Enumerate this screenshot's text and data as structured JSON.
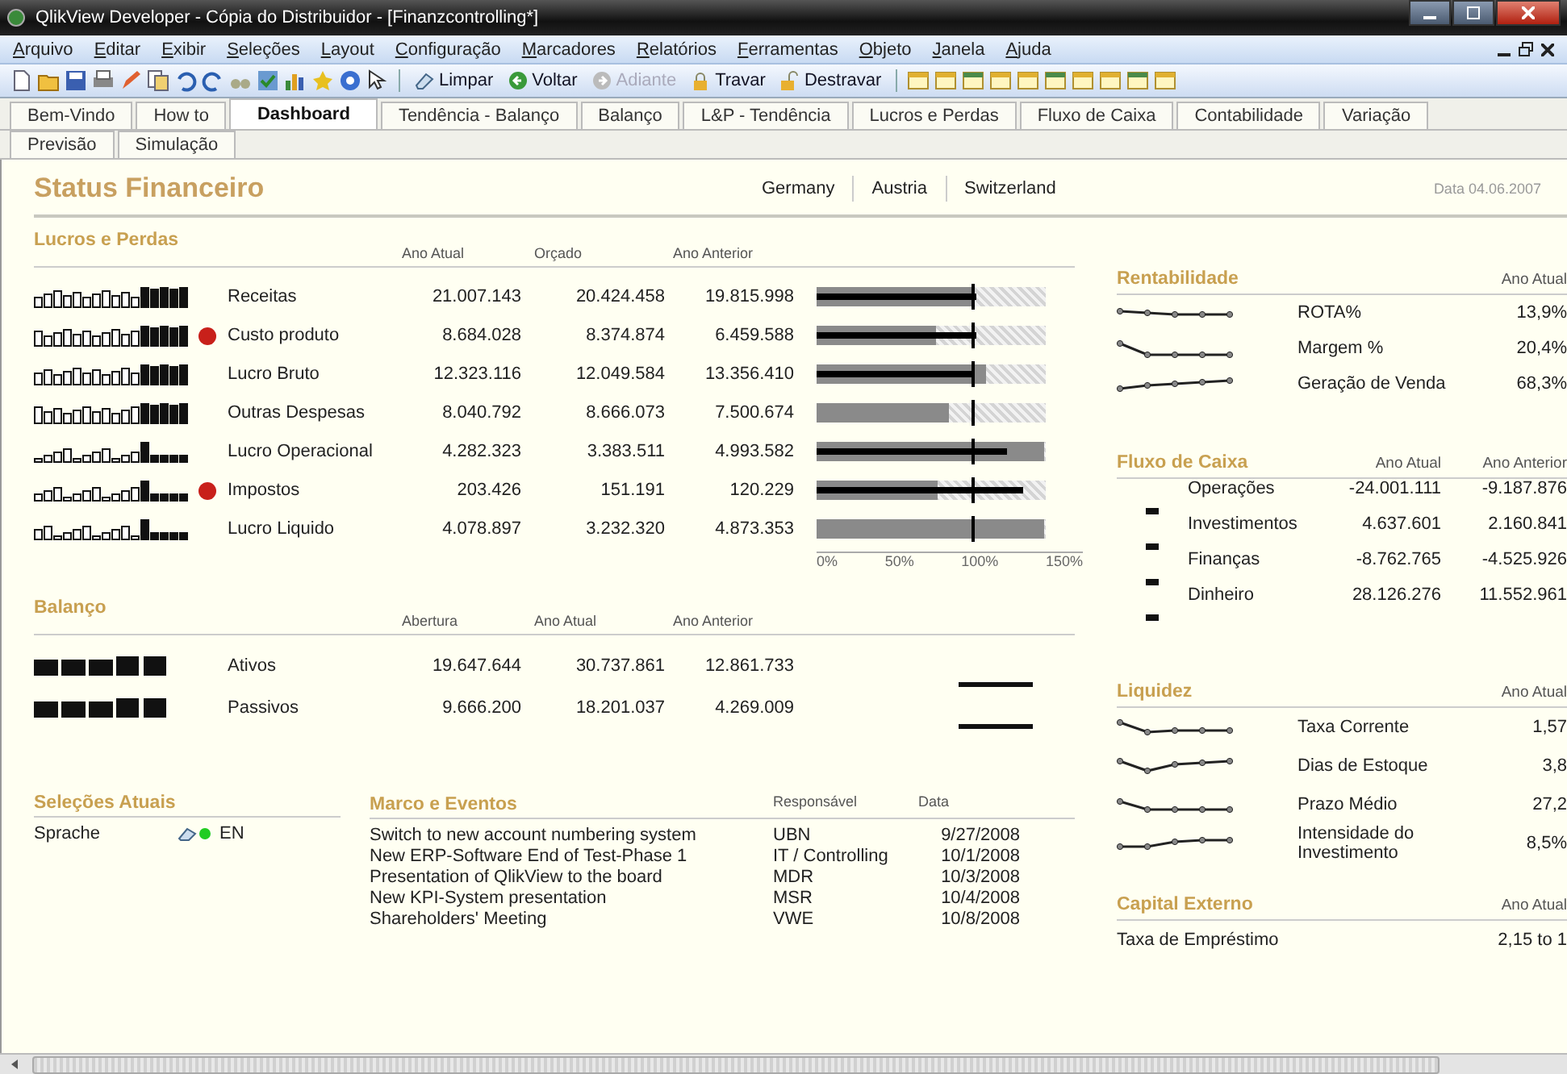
{
  "window": {
    "title": "QlikView Developer - Cópia do Distribuidor - [Finanzcontrolling*]"
  },
  "menu": [
    "Arquivo",
    "Editar",
    "Exibir",
    "Seleções",
    "Layout",
    "Configuração",
    "Marcadores",
    "Relatórios",
    "Ferramentas",
    "Objeto",
    "Janela",
    "Ajuda"
  ],
  "toolbar": {
    "buttons": [
      {
        "kind": "clear",
        "label": "Limpar",
        "disabled": false
      },
      {
        "kind": "back",
        "label": "Voltar",
        "disabled": false
      },
      {
        "kind": "forward",
        "label": "Adiante",
        "disabled": true
      },
      {
        "kind": "lock",
        "label": "Travar",
        "disabled": false
      },
      {
        "kind": "unlock",
        "label": "Destravar",
        "disabled": false
      }
    ]
  },
  "tabs": [
    {
      "label": "Bem-Vindo",
      "selected": false
    },
    {
      "label": "How to",
      "selected": false
    },
    {
      "label": "Dashboard",
      "selected": true
    },
    {
      "label": "Tendência - Balanço",
      "selected": false
    },
    {
      "label": "Balanço",
      "selected": false
    },
    {
      "label": "L&P - Tendência",
      "selected": false
    },
    {
      "label": "Lucros e Perdas",
      "selected": false
    },
    {
      "label": "Fluxo de Caixa",
      "selected": false
    },
    {
      "label": "Contabilidade",
      "selected": false
    },
    {
      "label": "Variação",
      "selected": false
    }
  ],
  "subtabs": [
    {
      "label": "Previsão",
      "selected": false
    },
    {
      "label": "Simulação",
      "selected": false
    }
  ],
  "dashboard": {
    "title": "Status Financeiro",
    "countries": [
      "Germany",
      "Austria",
      "Switzerland"
    ],
    "date": "Data 04.06.2007"
  },
  "profit_loss": {
    "title": "Lucros e Perdas",
    "columns": [
      "Ano Atual",
      "Orçado",
      "Ano Anterior"
    ],
    "axis": [
      "0%",
      "50%",
      "100%",
      "150%"
    ],
    "rows": [
      {
        "label": "Receitas",
        "alert": false,
        "current": "21.007.143",
        "budget": "20.424.458",
        "previous": "19.815.998",
        "wide_bar": {
          "level": 0.68
        },
        "thin_bar": {
          "level": 0.7
        },
        "target": {
          "level": 0.677
        }
      },
      {
        "label": "Custo produto",
        "alert": true,
        "current": "8.684.028",
        "budget": "8.374.874",
        "previous": "6.459.588",
        "wide_bar": {
          "level": 0.52
        },
        "thin_bar": {
          "level": 0.7
        },
        "target": {
          "level": 0.677
        }
      },
      {
        "label": "Lucro Bruto",
        "alert": false,
        "current": "12.323.116",
        "budget": "12.049.584",
        "previous": "13.356.410",
        "wide_bar": {
          "level": 0.74
        },
        "thin_bar": {
          "level": 0.68
        },
        "target": {
          "level": 0.677
        }
      },
      {
        "label": "Outras Despesas",
        "alert": false,
        "current": "8.040.792",
        "budget": "8.666.073",
        "previous": "7.500.674",
        "wide_bar": {
          "level": 0.58
        },
        "target": {
          "level": 0.677
        }
      },
      {
        "label": "Lucro Operacional",
        "alert": false,
        "current": "4.282.323",
        "budget": "3.383.511",
        "previous": "4.993.582",
        "wide_bar": {
          "level": 0.99
        },
        "thin_bar": {
          "level": 0.83
        },
        "target": {
          "level": 0.677
        }
      },
      {
        "label": "Impostos",
        "alert": true,
        "current": "203.426",
        "budget": "151.191",
        "previous": "120.229",
        "wide_bar": {
          "level": 0.53
        },
        "thin_bar": {
          "level": 0.9
        },
        "target": {
          "level": 0.677
        }
      },
      {
        "label": "Lucro Liquido",
        "alert": false,
        "current": "4.078.897",
        "budget": "3.232.320",
        "previous": "4.873.353",
        "wide_bar": {
          "level": 0.99
        },
        "target": {
          "level": 0.677
        }
      }
    ]
  },
  "balance": {
    "title": "Balanço",
    "columns": [
      "Abertura",
      "Ano Atual",
      "Ano Anterior"
    ],
    "rows": [
      {
        "label": "Ativos",
        "opening": "19.647.644",
        "current": "30.737.861",
        "previous": "12.861.733"
      },
      {
        "label": "Passivos",
        "opening": "9.666.200",
        "current": "18.201.037",
        "previous": "4.269.009"
      }
    ]
  },
  "selections": {
    "title": "Seleções Atuais",
    "rows": [
      {
        "field": "Sprache",
        "value": "EN"
      }
    ]
  },
  "events": {
    "title": "Marco e Eventos",
    "columns": [
      "Responsável",
      "Data"
    ],
    "rows": [
      {
        "text": "Switch to new account numbering system",
        "owner": "UBN",
        "date": "9/27/2008"
      },
      {
        "text": "New ERP-Software End of Test-Phase 1",
        "owner": "IT / Controlling",
        "date": "10/1/2008"
      },
      {
        "text": "Presentation of QlikView to the board",
        "owner": "MDR",
        "date": "10/3/2008"
      },
      {
        "text": "New KPI-System presentation",
        "owner": "MSR",
        "date": "10/4/2008"
      },
      {
        "text": "Shareholders' Meeting",
        "owner": "VWE",
        "date": "10/8/2008"
      }
    ]
  },
  "profitability": {
    "title": "Rentabilidade",
    "column": "Ano Atual",
    "rows": [
      {
        "label": "ROTA%",
        "value": "13,9%"
      },
      {
        "label": "Margem %",
        "value": "20,4%"
      },
      {
        "label": "Geração de Venda",
        "value": "68,3%"
      }
    ]
  },
  "cash_flow": {
    "title": "Fluxo de Caixa",
    "columns": [
      "Ano Atual",
      "Ano Anterior"
    ],
    "rows": [
      {
        "label": "Operações",
        "current": "-24.001.111",
        "previous": "-9.187.876"
      },
      {
        "label": "Investimentos",
        "current": "4.637.601",
        "previous": "2.160.841"
      },
      {
        "label": "Finanças",
        "current": "-8.762.765",
        "previous": "-4.525.926"
      },
      {
        "label": "Dinheiro",
        "current": "28.126.276",
        "previous": "11.552.961"
      }
    ]
  },
  "liquidity": {
    "title": "Liquidez",
    "column": "Ano Atual",
    "rows": [
      {
        "label": "Taxa Corrente",
        "value": "1,57"
      },
      {
        "label": "Dias de Estoque",
        "value": "3,8"
      },
      {
        "label": "Prazo Médio",
        "value": "27,2"
      },
      {
        "label": "Intensidade do Investimento",
        "value": "8,5%"
      }
    ]
  },
  "external_capital": {
    "title": "Capital Externo",
    "column": "Ano Atual",
    "rows": [
      {
        "label": "Taxa de Empréstimo",
        "value": "2,15 to 1"
      }
    ]
  }
}
